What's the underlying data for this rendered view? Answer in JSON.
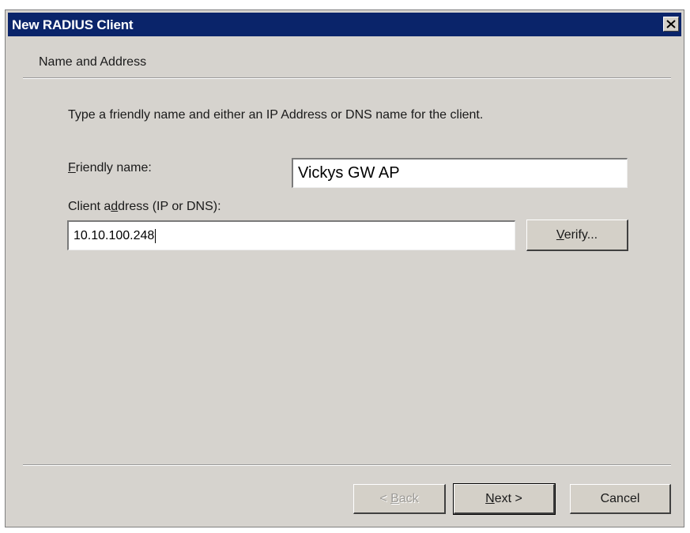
{
  "window": {
    "title": "New RADIUS Client",
    "close_icon": "close-icon"
  },
  "page": {
    "section_title": "Name and Address",
    "instruction": "Type a friendly name and either an IP Address or DNS name for the client."
  },
  "form": {
    "friendly_name": {
      "label_prefix": "",
      "label_accel": "F",
      "label_rest": "riendly name:",
      "value": "Vickys GW AP"
    },
    "client_address": {
      "label_prefix": "Client a",
      "label_accel": "d",
      "label_rest": "dress (IP or DNS):",
      "value": "10.10.100.248"
    },
    "verify_button": {
      "accel": "V",
      "rest": "erify..."
    }
  },
  "footer": {
    "back_button": {
      "prefix": "< ",
      "accel": "B",
      "rest": "ack"
    },
    "next_button": {
      "accel": "N",
      "rest": "ext >"
    },
    "cancel_button": "Cancel"
  }
}
